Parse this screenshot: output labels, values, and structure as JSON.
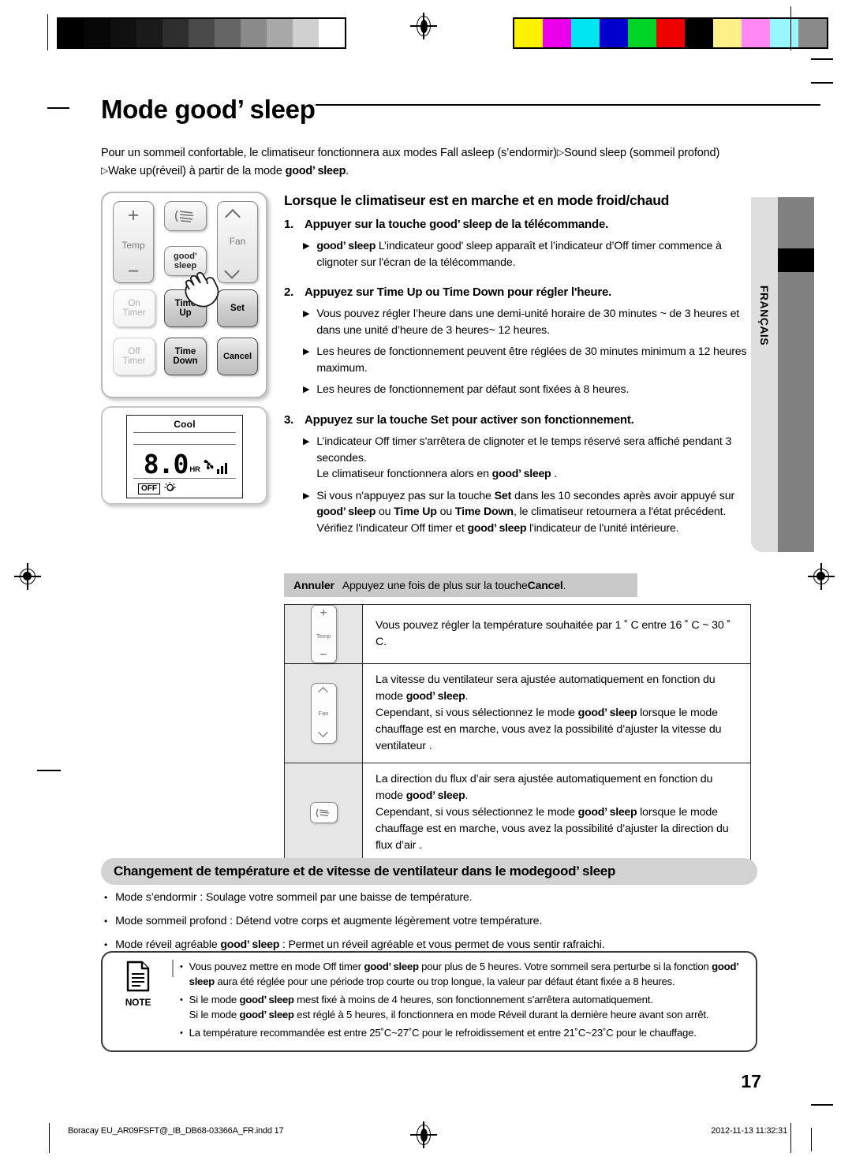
{
  "prepress": {
    "gray_steps": [
      "#000000",
      "#070707",
      "#101010",
      "#1a1a1a",
      "#2e2e2e",
      "#4a4a4a",
      "#656565",
      "#8a8a8a",
      "#a8a8a8",
      "#d0d0d0",
      "#ffffff"
    ],
    "color_patches": [
      "#fff200",
      "#ec00ec",
      "#00e5f2",
      "#0000cc",
      "#00d426",
      "#ee0000",
      "#000000",
      "#fff089",
      "#ff88f4",
      "#97f7ff",
      "#8a8a8a"
    ]
  },
  "header": {
    "title_prefix": "Mode ",
    "title_brand": "good’ sleep"
  },
  "intro": {
    "line1_a": "Pour un sommeil confortable, le climatiseur fonctionnera aux modes Fall asleep (s’endormir)",
    "line1_b": "Sound sleep (sommeil profond)",
    "line2_a": "Wake up(réveil) à partir de la mode ",
    "line2_brand": "good’ sleep",
    "line2_b": "."
  },
  "remote": {
    "keys": {
      "temp_plus": "+",
      "temp_label": "Temp",
      "temp_minus": "−",
      "swing": "swing-icon",
      "good_sleep_l1": "good’",
      "good_sleep_l2": "sleep",
      "fan_label": "Fan",
      "on_timer_l1": "On",
      "on_timer_l2": "Timer",
      "time_up_l1": "Time",
      "time_up_l2": "Up",
      "set": "Set",
      "off_timer_l1": "Off",
      "off_timer_l2": "Timer",
      "time_down_l1": "Time",
      "time_down_l2": "Down",
      "cancel": "Cancel"
    }
  },
  "lcd": {
    "mode": "Cool",
    "value": "8.0",
    "unit": "HR",
    "fan_icon": "fan-icon",
    "signal_bars": 3,
    "off_label": "OFF",
    "sleep_icon": "good-sleep-icon"
  },
  "main": {
    "heading": "Lorsque le climatiseur est en marche et en mode froid/chaud",
    "steps": [
      {
        "num": "1.",
        "text_a": "Appuyer sur la touche ",
        "brand": "good’ sleep",
        "text_b": " de la télécommande.",
        "subs": [
          {
            "brand_lead": "good’ sleep",
            "text": " L’indicateur good' sleep apparaît et  l’indicateur d’Off timer commence à clignoter sur l'écran de la télécommande."
          }
        ]
      },
      {
        "num": "2.",
        "text_a": "Appuyez sur Time Up ou Time Down pour régler l'heure.",
        "subs": [
          {
            "text": "Vous pouvez régler l’heure dans une demi-unité horaire de 30 minutes ~ de 3 heures et dans une unité d’heure de 3 heures~ 12 heures."
          },
          {
            "text": "Les heures de fonctionnement peuvent être réglées de 30 minutes minimum a 12 heures maximum."
          },
          {
            "text": "Les heures de fonctionnement par défaut sont fixées à 8 heures."
          }
        ]
      },
      {
        "num": "3.",
        "text_a": "Appuyez sur la touche Set pour activer son fonctionnement.",
        "subs": [
          {
            "text": "L’indicateur Off timer s'arrêtera de clignoter et le temps réservé sera affiché pendant 3 secondes.",
            "line2_a": "Le climatiseur fonctionnera alors en ",
            "line2_brand": "good’ sleep",
            "line2_b": " ."
          },
          {
            "p1": "Si vous n'appuyez pas sur la touche ",
            "b1": "Set",
            "p2": " dans les 10 secondes après avoir appuyé sur ",
            "brand1": "good’ sleep",
            "p3": " ou ",
            "b2": "Time Up",
            "p4": " ou ",
            "b3": "Time Down",
            "p5": ", le climatiseur retournera a l'état précédent. Vérifiez l'indicateur Off timer et  ",
            "brand2": "good’ sleep",
            "p6": " l'indicateur de l'unité intérieure."
          }
        ]
      }
    ]
  },
  "annuler": {
    "label": "Annuler",
    "text_a": "Appuyez une fois de plus sur la touche ",
    "bold": "Cancel",
    "text_b": "."
  },
  "table": {
    "rows": [
      {
        "icon": "temp-key-icon",
        "icon_labels": {
          "plus": "+",
          "name": "Temp",
          "minus": "−"
        },
        "paragraphs": [
          {
            "text": "Vous pouvez régler la température souhaitée par 1 ˚ C entre 16 ˚ C ~ 30 ˚ C."
          }
        ]
      },
      {
        "icon": "fan-key-icon",
        "icon_labels": {
          "name": "Fan"
        },
        "paragraphs": [
          {
            "text_a": "La vitesse du ventilateur sera ajustée automatiquement en fonction du mode ",
            "brand": "good’ sleep",
            "text_b": "."
          },
          {
            "text_a": "Cependant, si vous sélectionnez le mode ",
            "brand": "good’ sleep",
            "text_b": " lorsque le mode chauffage est en marche, vous avez la possibilité d’ajuster la vitesse du ventilateur ."
          }
        ]
      },
      {
        "icon": "swing-key-icon",
        "icon_labels": {},
        "paragraphs": [
          {
            "text_a": "La direction du flux d’air sera ajustée automatiquement en fonction du mode ",
            "brand": "good’ sleep",
            "text_b": "."
          },
          {
            "text_a": "Cependant, si vous sélectionnez le mode ",
            "brand": "good’ sleep",
            "text_b": " lorsque le mode chauffage est en marche, vous avez la possibilité d’ajuster la direction du flux d’air ."
          }
        ]
      }
    ]
  },
  "band": {
    "text_a": "Changement de température et de vitesse de ventilateur dans le mode ",
    "brand": "good’ sleep"
  },
  "bullets": [
    {
      "text": "Mode s’endormir : Soulage votre sommeil par une baisse de température."
    },
    {
      "text": "Mode sommeil profond : Détend votre corps et augmente légèrement votre température."
    },
    {
      "text_a": "Mode réveil agréable ",
      "brand": "good’ sleep",
      "text_b": " : Permet un réveil agréable et vous permet de vous sentir rafraichi."
    }
  ],
  "note": {
    "icon": "note-document-icon",
    "label": "NOTE",
    "items": [
      {
        "p1": "Vous pouvez mettre en mode Off timer ",
        "brand1": "good’ sleep",
        "p2": " pour plus de 5 heures. Votre sommeil sera perturbe si la fonction ",
        "brand2": "good’ sleep",
        "p3": " aura été réglée pour une période trop courte ou trop longue, la valeur par défaut étant fixée a 8 heures."
      },
      {
        "p1": "Si le mode ",
        "brand1": "good’ sleep",
        "p2": " mest fixé à moins de 4 heures, son fonctionnement s’arrêtera automatiquement.",
        "l2_p1": "Si le mode ",
        "l2_brand": "good’ sleep",
        "l2_p2": " est réglé à 5 heures, il fonctionnera en mode Réveil durant la dernière heure avant son arrêt."
      },
      {
        "p1": "La température recommandée est entre 25˚C~27˚C pour le refroidissement et entre 21˚C~23˚C pour le chauffage."
      }
    ]
  },
  "sidetab": {
    "language": "FRANÇAIS"
  },
  "page_number": "17",
  "footer": {
    "left": "Boracay EU_AR09FSFT@_IB_DB68-03366A_FR.indd   17",
    "right": "2012-11-13   11:32:31"
  }
}
